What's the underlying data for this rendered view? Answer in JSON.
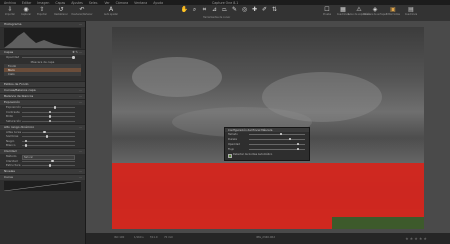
{
  "window": {
    "title": "Capture One 8.1"
  },
  "menubar": [
    "Archivo",
    "Editar",
    "Imagen",
    "Capas",
    "Ajustes",
    "Selec.",
    "Ver",
    "Cámara",
    "Ventana",
    "Ayuda"
  ],
  "toolbar": {
    "left": [
      {
        "icon": "import-icon",
        "label": "Importar"
      },
      {
        "icon": "capture-icon",
        "label": "Capturar"
      },
      {
        "icon": "export-icon",
        "label": "Exportar"
      }
    ],
    "mid_left": [
      {
        "icon": "reset-icon",
        "label": "Restablecer"
      },
      {
        "icon": "undo-icon",
        "label": "Deshacer/Rehacer"
      }
    ],
    "mid": [
      {
        "icon": "auto-adjust-icon",
        "label": "Auto ajustar"
      }
    ],
    "cursor_tools": [
      {
        "icon": "pan-icon",
        "label": ""
      },
      {
        "icon": "loupe-icon",
        "label": ""
      },
      {
        "icon": "crop-icon",
        "label": ""
      },
      {
        "icon": "straighten-icon",
        "label": ""
      },
      {
        "icon": "keystone-icon",
        "label": ""
      },
      {
        "icon": "brush-icon",
        "label": ""
      },
      {
        "icon": "spot-icon",
        "label": ""
      },
      {
        "icon": "picker-icon",
        "label": ""
      },
      {
        "icon": "annotate-icon",
        "label": ""
      },
      {
        "icon": "copy-apply-icon",
        "label": ""
      }
    ],
    "cursor_tools_label": "Herramientas de cursor",
    "right": [
      {
        "icon": "proof-icon",
        "label": "Prueba"
      },
      {
        "icon": "grid-icon",
        "label": "Cuadrícula"
      },
      {
        "icon": "exposure-warn-icon",
        "label": "Aviso de exposición"
      },
      {
        "icon": "focus-icon",
        "label": "Máscara de enfoque"
      },
      {
        "icon": "edit-all-icon",
        "label": "Editar todas"
      },
      {
        "icon": "layout-icon",
        "label": "Cuadrícula"
      }
    ]
  },
  "left_panel": {
    "histogram_title": "Histograma",
    "capas_title": "Capas",
    "capas_row": "Opacidad",
    "layers_header": "Máscara de capa",
    "layers": [
      {
        "name": "Fondo",
        "selected": false
      },
      {
        "name": "Muro",
        "selected": true
      },
      {
        "name": "Cielo",
        "selected": false
      }
    ],
    "sections": [
      {
        "title": "Estilos de Fondo",
        "rows": []
      },
      {
        "title": "Curvas/Balance capa",
        "rows": []
      },
      {
        "title": "Balance de blancos",
        "rows": []
      },
      {
        "title": "Exposición",
        "rows": [
          "Exposición",
          "Contraste",
          "Brillo",
          "Saturación"
        ]
      },
      {
        "title": "Alto rango dinámico",
        "rows": [
          "Altas luces",
          "Sombras",
          "Negro",
          "Blanco"
        ]
      },
      {
        "title": "Claridad",
        "rows": [
          "Método",
          "Claridad",
          "Estructura"
        ]
      },
      {
        "title": "Niveles",
        "rows": []
      },
      {
        "title": "Curva",
        "rows": []
      }
    ],
    "clarity_method_value": "Natural"
  },
  "dialog": {
    "title": "Configuración del Pincel Máscara",
    "rows": [
      "Tamaño",
      "Dureza",
      "Opacidad",
      "Flujo"
    ],
    "levels": [
      0.55,
      0.72,
      0.85,
      0.85
    ],
    "checkbox_label": "Detectar de bordes Automático"
  },
  "status": {
    "left": "ISO 100",
    "mid": [
      "1/160 s",
      "f/11.0",
      "70 mm"
    ],
    "center": "IMG_2340.CR2"
  },
  "colors": {
    "mask": "#d8231a",
    "accent": "#6b4d3a"
  }
}
